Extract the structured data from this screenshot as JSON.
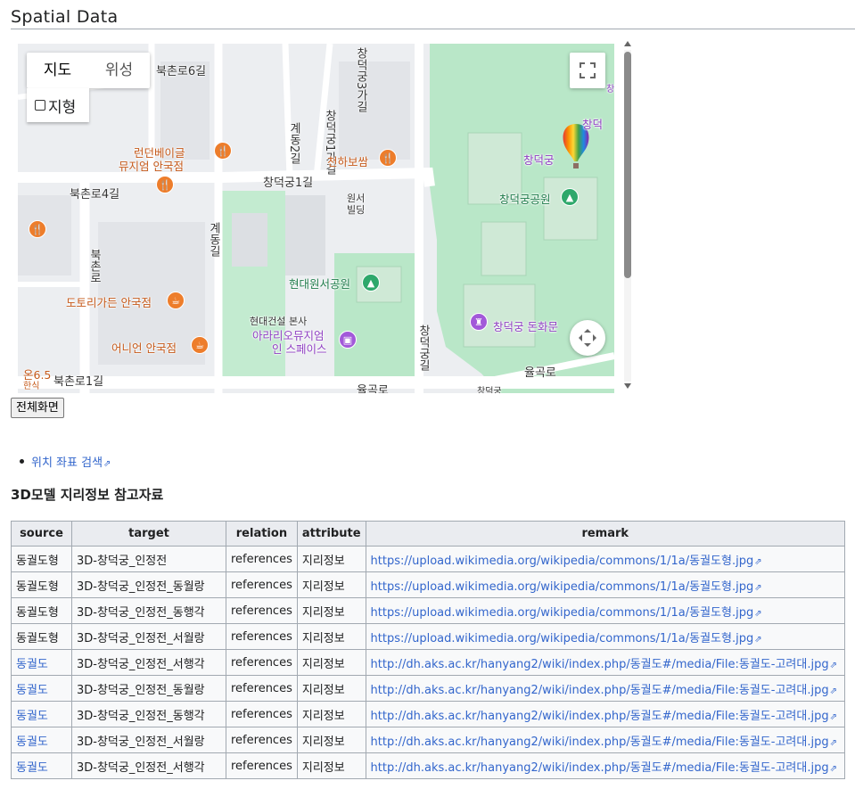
{
  "section_title": "Spatial Data",
  "map": {
    "type_buttons": [
      "지도",
      "위성"
    ],
    "terrain_label": "지형",
    "labels": [
      {
        "text": "북촌로6길"
      },
      {
        "text": "창덕궁3가길"
      },
      {
        "text": "창덕궁1가길"
      },
      {
        "text": "계동2길"
      },
      {
        "text": "런던베이글"
      },
      {
        "text": "뮤지엄 안국점"
      },
      {
        "text": "천하보쌈"
      },
      {
        "text": "창덕궁1길"
      },
      {
        "text": "원서"
      },
      {
        "text": "빌딩"
      },
      {
        "text": "북촌로4길"
      },
      {
        "text": "창덕궁"
      },
      {
        "text": "창덕궁공원"
      },
      {
        "text": "현대원서공원"
      },
      {
        "text": "도토리가든 안국점"
      },
      {
        "text": "현대건설 본사"
      },
      {
        "text": "아라리오뮤지엄"
      },
      {
        "text": "인 스페이스"
      },
      {
        "text": "창덕궁 돈화문"
      },
      {
        "text": "어니언 안국점"
      },
      {
        "text": "온6.5"
      },
      {
        "text": "한식"
      },
      {
        "text": "북촌로1길"
      },
      {
        "text": "율곡로"
      },
      {
        "text": "율곡로"
      },
      {
        "text": "창덕궁길"
      },
      {
        "text": "계동길"
      },
      {
        "text": "북촌로"
      },
      {
        "text": "창덕궁"
      },
      {
        "text": "창덕"
      },
      {
        "text": "창덕궁"
      }
    ]
  },
  "fullscreen_label": "전체화면",
  "links": [
    {
      "label": "위치 좌표 검색"
    }
  ],
  "subheading": "3D모델 지리정보 참고자료",
  "table": {
    "headers": [
      "source",
      "target",
      "relation",
      "attribute",
      "remark"
    ],
    "rows": [
      {
        "source": "동궐도형",
        "target": "3D-창덕궁_인정전",
        "relation": "references",
        "attribute": "지리정보",
        "remark": "https://upload.wikimedia.org/wikipedia/commons/1/1a/동궐도형.jpg"
      },
      {
        "source": "동궐도형",
        "target": "3D-창덕궁_인정전_동월랑",
        "relation": "references",
        "attribute": "지리정보",
        "remark": "https://upload.wikimedia.org/wikipedia/commons/1/1a/동궐도형.jpg"
      },
      {
        "source": "동궐도형",
        "target": "3D-창덕궁_인정전_동행각",
        "relation": "references",
        "attribute": "지리정보",
        "remark": "https://upload.wikimedia.org/wikipedia/commons/1/1a/동궐도형.jpg"
      },
      {
        "source": "동궐도형",
        "target": "3D-창덕궁_인정전_서월랑",
        "relation": "references",
        "attribute": "지리정보",
        "remark": "https://upload.wikimedia.org/wikipedia/commons/1/1a/동궐도형.jpg"
      },
      {
        "source": "동궐도",
        "target": "3D-창덕궁_인정전_서행각",
        "relation": "references",
        "attribute": "지리정보",
        "remark": "http://dh.aks.ac.kr/hanyang2/wiki/index.php/동궐도#/media/File:동궐도-고려대.jpg"
      },
      {
        "source": "동궐도",
        "target": "3D-창덕궁_인정전_동월랑",
        "relation": "references",
        "attribute": "지리정보",
        "remark": "http://dh.aks.ac.kr/hanyang2/wiki/index.php/동궐도#/media/File:동궐도-고려대.jpg"
      },
      {
        "source": "동궐도",
        "target": "3D-창덕궁_인정전_동행각",
        "relation": "references",
        "attribute": "지리정보",
        "remark": "http://dh.aks.ac.kr/hanyang2/wiki/index.php/동궐도#/media/File:동궐도-고려대.jpg"
      },
      {
        "source": "동궐도",
        "target": "3D-창덕궁_인정전_서월랑",
        "relation": "references",
        "attribute": "지리정보",
        "remark": "http://dh.aks.ac.kr/hanyang2/wiki/index.php/동궐도#/media/File:동궐도-고려대.jpg"
      },
      {
        "source": "동궐도",
        "target": "3D-창덕궁_인정전_서행각",
        "relation": "references",
        "attribute": "지리정보",
        "remark": "http://dh.aks.ac.kr/hanyang2/wiki/index.php/동궐도#/media/File:동궐도-고려대.jpg"
      }
    ]
  },
  "colors": {
    "link": "#3366cc",
    "park": "#b7e6c6",
    "road": "#ffffff",
    "map_bg": "#eef0f2"
  }
}
